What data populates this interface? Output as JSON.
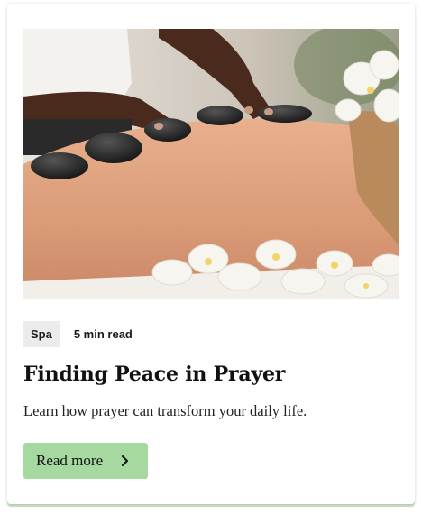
{
  "card": {
    "image_alt": "Hot stone massage with orchids",
    "tag": "Spa",
    "read_time": "5 min read",
    "title": "Finding Peace in Prayer",
    "description": "Learn how prayer can transform your daily life.",
    "button_label": "Read more",
    "button_icon": "chevron-right-icon"
  },
  "colors": {
    "button_bg": "#a5d9a0",
    "tag_bg": "#ebebeb",
    "card_shadow_accent": "#cfe6c8"
  }
}
